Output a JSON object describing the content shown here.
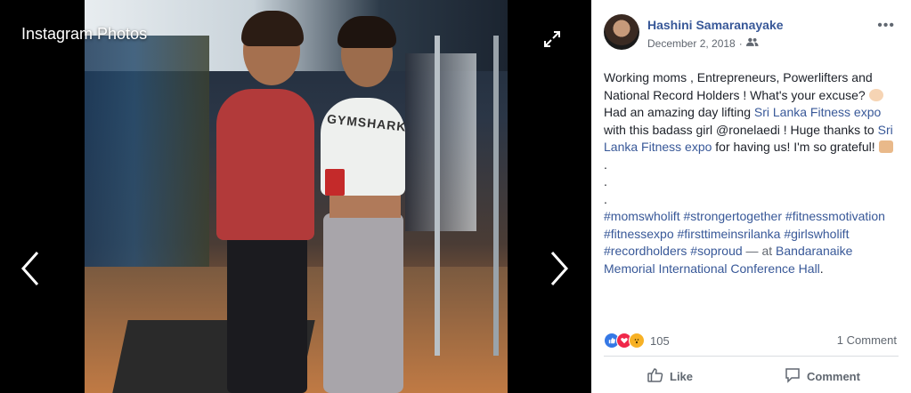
{
  "viewer": {
    "title": "Instagram Photos",
    "shirt_text": "GYMSHARK"
  },
  "post": {
    "author": "Hashini Samaranayake",
    "date": "December 2, 2018",
    "options": "•••",
    "paragraph1": {
      "t1": "Working moms , Entrepreneurs, Powerlifters and National Record Holders ! What's your excuse? ",
      "t2": " Had an amazing day lifting ",
      "link1": "Sri Lanka Fitness expo",
      "t3": " with this badass girl @ronelaedi ! Huge thanks to ",
      "link2": "Sri Lanka Fitness expo",
      "t4": " for having us! I'm so grateful! "
    },
    "dots": [
      ".",
      ".",
      "."
    ],
    "hashtags": {
      "h1": "#momswholift",
      "h2": "#strongertogether",
      "h3": "#fitnessmotivation",
      "h4": "#fitnessexpo",
      "h5": "#firsttimeinsrilanka",
      "h6": "#girlswholift",
      "h7": "#recordholders",
      "h8": "#soproud",
      "at": " — at ",
      "place": "Bandaranaike Memorial International Conference Hall",
      "end": "."
    },
    "reaction_count": "105",
    "comment_count": "1 Comment",
    "like_label": "Like",
    "comment_label": "Comment"
  },
  "colors": {
    "link": "#385898",
    "like": "#3578e5",
    "love": "#f0284a",
    "wow": "#f7b125"
  },
  "icons": [
    "expand-icon",
    "chevron-left-icon",
    "chevron-right-icon",
    "friends-icon",
    "thumbs-up-icon",
    "comment-icon"
  ]
}
